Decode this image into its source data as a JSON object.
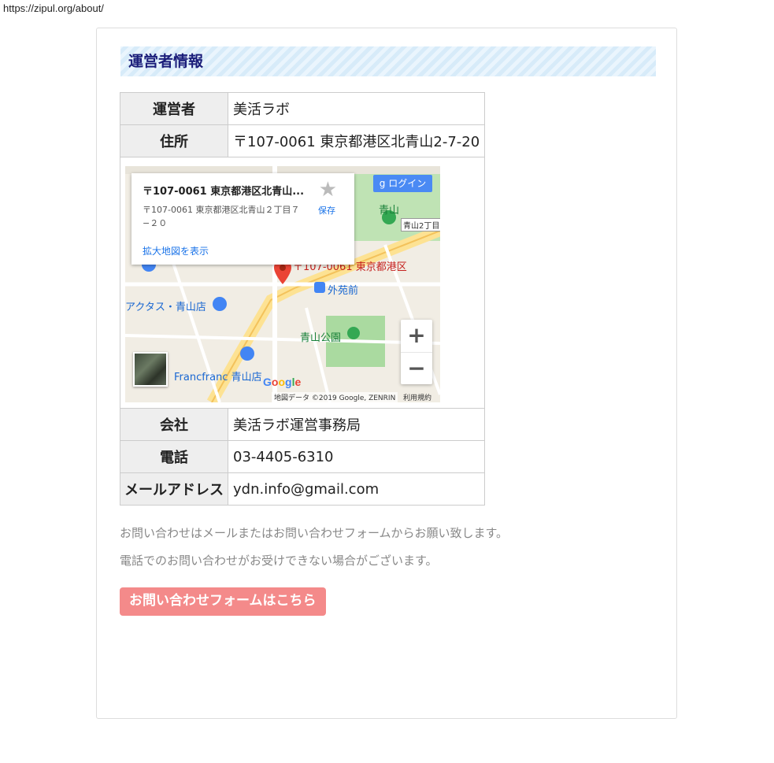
{
  "browser": {
    "url": "https://zipul.org/about/"
  },
  "section": {
    "title": "運営者情報"
  },
  "table": {
    "operator_label": "運営者",
    "operator_value": "美活ラボ",
    "address_label": "住所",
    "address_value": "〒107-0061 東京都港区北青山2-7-20",
    "company_label": "会社",
    "company_value": "美活ラボ運営事務局",
    "phone_label": "電話",
    "phone_value": "03-4405-6310",
    "email_label": "メールアドレス",
    "email_value": "ydn.info@gmail.com"
  },
  "map": {
    "card_title": "〒107-0061 東京都港区北青山...",
    "card_address": "〒107-0061 東京都港区北青山２丁目７−２０",
    "save_label": "保存",
    "enlarge_link": "拡大地図を表示",
    "login_label": "ログイン",
    "labels": {
      "pin": "〒107-0061 東京都港区",
      "station": "外苑前",
      "park": "青山公園",
      "store1": "アクタス・青山店",
      "store2": "Francfranc 青山店",
      "aoyama": "青山",
      "aoyama2": "青山2丁目"
    },
    "google_logo": "Google",
    "copyright": "地図データ ©2019 Google, ZENRIN",
    "terms": "利用規約",
    "zoom_in": "+",
    "zoom_out": "−",
    "colors": {
      "pin": "#ea4335",
      "park": "#aadaa0",
      "road": "#fde293",
      "login": "#4a8af4"
    }
  },
  "notes": {
    "line1": "お問い合わせはメールまたはお問い合わせフォームからお願い致します。",
    "line2": "電話でのお問い合わせがお受けできない場合がございます。"
  },
  "contact": {
    "button_label": "お問い合わせフォームはこちら",
    "color": "#f48a8a"
  }
}
